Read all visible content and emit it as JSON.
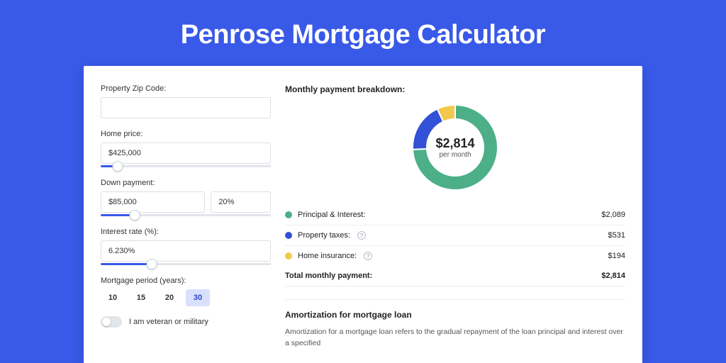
{
  "title": "Penrose Mortgage Calculator",
  "form": {
    "zip_label": "Property Zip Code:",
    "zip_value": "",
    "price_label": "Home price:",
    "price_value": "$425,000",
    "price_slider_pct": 10,
    "down_label": "Down payment:",
    "down_value": "$85,000",
    "down_pct_value": "20%",
    "down_slider_pct": 20,
    "rate_label": "Interest rate (%):",
    "rate_value": "6.230%",
    "rate_slider_pct": 30,
    "period_label": "Mortgage period (years):",
    "periods": [
      "10",
      "15",
      "20",
      "30"
    ],
    "period_selected": "30",
    "veteran_label": "I am veteran or military"
  },
  "breakdown": {
    "heading": "Monthly payment breakdown:",
    "amount": "$2,814",
    "per": "per month",
    "items": [
      {
        "label": "Principal & Interest:",
        "value": "$2,089",
        "color": "#4caf87",
        "info": false
      },
      {
        "label": "Property taxes:",
        "value": "$531",
        "color": "#3351d6",
        "info": true
      },
      {
        "label": "Home insurance:",
        "value": "$194",
        "color": "#f2c94c",
        "info": true
      }
    ],
    "total_label": "Total monthly payment:",
    "total_value": "$2,814"
  },
  "amort": {
    "heading": "Amortization for mortgage loan",
    "text": "Amortization for a mortgage loan refers to the gradual repayment of the loan principal and interest over a specified"
  },
  "chart_data": {
    "type": "pie",
    "title": "Monthly payment breakdown",
    "series": [
      {
        "name": "Principal & Interest",
        "value": 2089,
        "color": "#4caf87"
      },
      {
        "name": "Property taxes",
        "value": 531,
        "color": "#3351d6"
      },
      {
        "name": "Home insurance",
        "value": 194,
        "color": "#f2c94c"
      }
    ],
    "total": 2814,
    "center_label": "$2,814 per month"
  }
}
